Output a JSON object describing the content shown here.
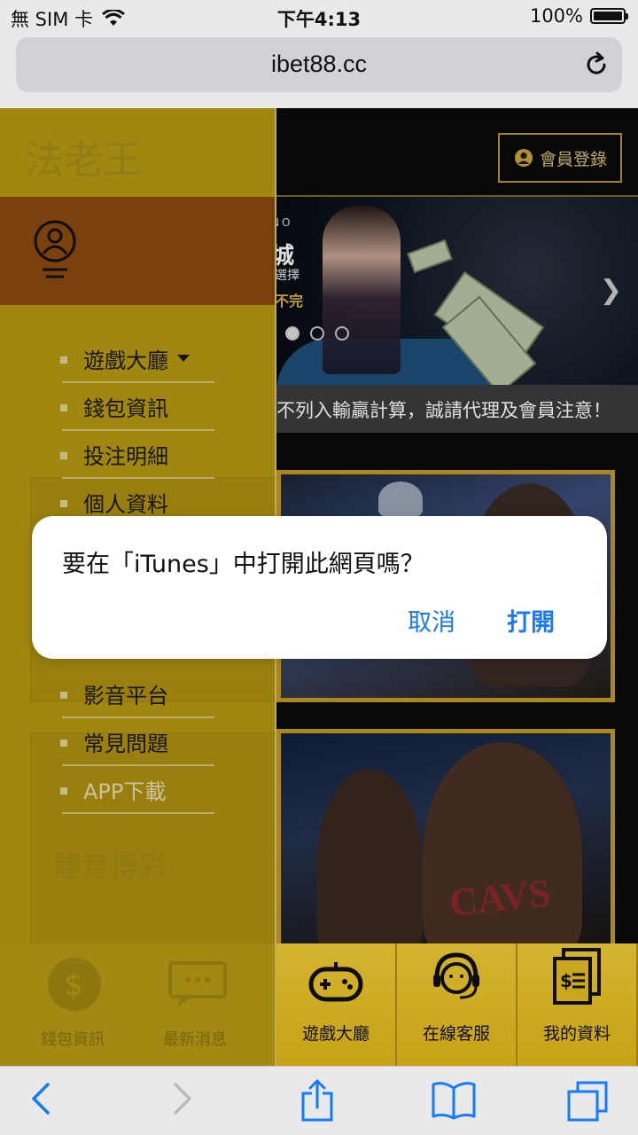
{
  "status_bar": {
    "carrier": "無 SIM 卡",
    "time": "下午4:13",
    "battery": "100%"
  },
  "browser": {
    "url": "ibet88.cc"
  },
  "page": {
    "login_button": "會員登錄",
    "banner": {
      "title": "城",
      "title_prefix": "NO",
      "line1": "選擇",
      "line2": "不完"
    },
    "marquee": "不列入輸贏計算，誠請代理及會員注意！",
    "bottom_nav": [
      {
        "label": "遊戲大廳",
        "icon": "gamepad-icon"
      },
      {
        "label": "在線客服",
        "icon": "headset-support-icon"
      },
      {
        "label": "我的資料",
        "icon": "document-money-icon"
      }
    ]
  },
  "drawer": {
    "logo": "法老王",
    "menu": [
      {
        "label": "遊戲大廳",
        "has_dropdown": true
      },
      {
        "label": "錢包資訊"
      },
      {
        "label": "投注明細"
      },
      {
        "label": "個人資料"
      },
      {
        "label": "影音平台"
      },
      {
        "label": "常見問題"
      },
      {
        "label": "APP下載"
      }
    ],
    "background_text": "體育博彩",
    "bottom_nav": [
      {
        "label": "錢包資訊"
      },
      {
        "label": "最新消息"
      }
    ]
  },
  "dialog": {
    "title": "要在「iTunes」中打開此網頁嗎？",
    "cancel_label": "取消",
    "open_label": "打開"
  },
  "colors": {
    "drawer": "#b79a12",
    "drawer_header": "#8b4a12",
    "accent_blue": "#147aff",
    "gold": "#e4b91a"
  }
}
